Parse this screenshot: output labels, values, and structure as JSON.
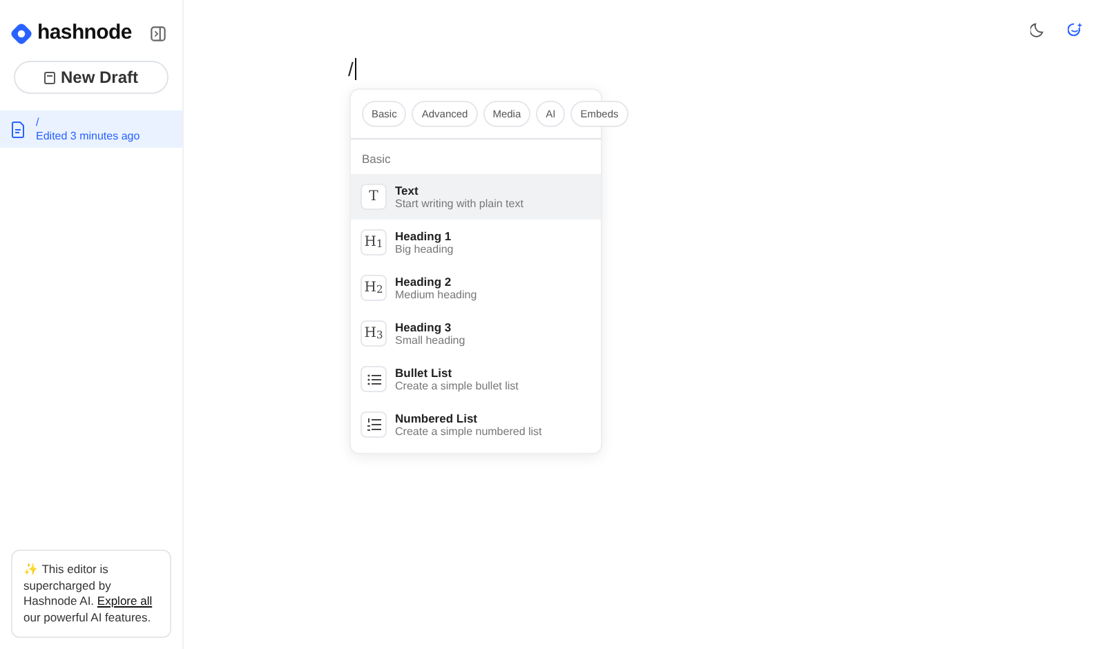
{
  "sidebar": {
    "logo": "hashnode",
    "new_draft": "New Draft",
    "drafts": [
      {
        "title": "/",
        "meta": "Edited 3 minutes ago",
        "selected": true
      }
    ],
    "promo": {
      "emoji": "✨",
      "text": "This editor is supercharged by Hashnode AI. ",
      "link": "Explore all",
      "text_after": " our powerful AI features."
    }
  },
  "editor": {
    "content": "/"
  },
  "menu": {
    "tabs": [
      {
        "label": "Basic",
        "selected": false
      },
      {
        "label": "Advanced",
        "selected": false
      },
      {
        "label": "Media",
        "selected": false
      },
      {
        "label": "AI",
        "selected": false
      },
      {
        "label": "Embeds",
        "selected": false
      }
    ],
    "section": "Basic",
    "items": [
      {
        "kind": "glyph",
        "glyph": "T",
        "title": "Text",
        "description": "Start writing with plain text",
        "selected": true
      },
      {
        "kind": "glyph",
        "glyph": "H$_{1}$",
        "title": "Heading 1",
        "description": "Big heading",
        "selected": false
      },
      {
        "kind": "glyph",
        "glyph": "H$_{2}$",
        "title": "Heading 2",
        "description": "Medium heading",
        "selected": false
      },
      {
        "kind": "glyph",
        "glyph": "H$_{3}$",
        "title": "Heading 3",
        "description": "Small heading",
        "selected": false
      },
      {
        "kind": "bullets",
        "title": "Bullet List",
        "description": "Create a simple bullet list",
        "selected": false
      },
      {
        "kind": "numbers",
        "title": "Numbered List",
        "description": "Create a simple numbered list",
        "selected": false
      }
    ]
  }
}
